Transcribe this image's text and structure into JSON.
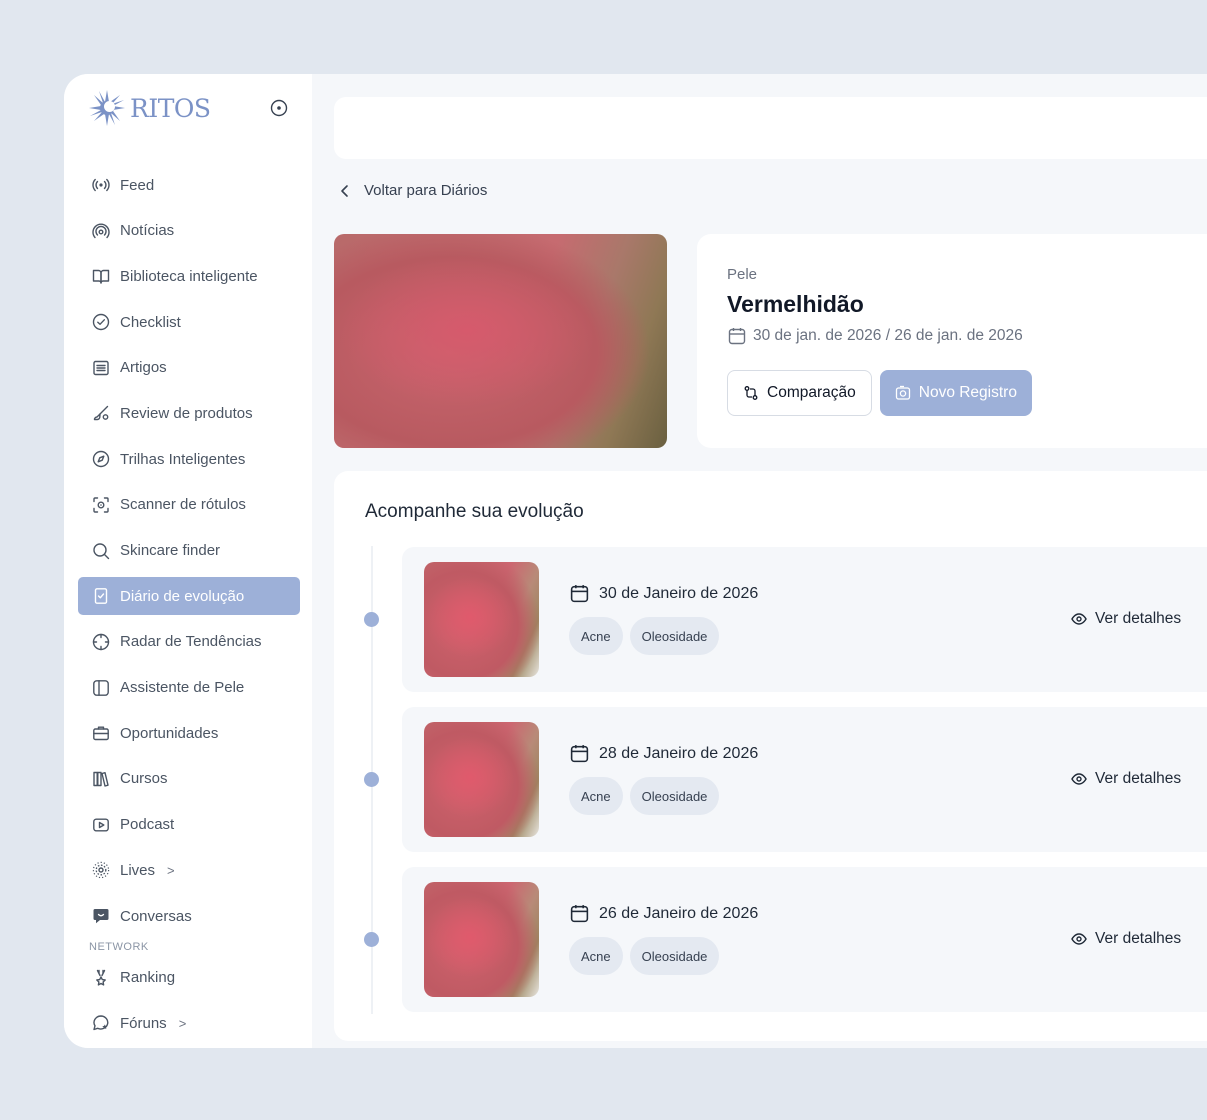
{
  "brand": {
    "name": "RITOS",
    "accent": "#9db0d8"
  },
  "sidebar": {
    "items": [
      {
        "label": "Feed",
        "icon": "broadcast-icon"
      },
      {
        "label": "Notícias",
        "icon": "signal-icon"
      },
      {
        "label": "Biblioteca inteligente",
        "icon": "book-open-icon"
      },
      {
        "label": "Checklist",
        "icon": "check-circle-icon"
      },
      {
        "label": "Artigos",
        "icon": "article-icon"
      },
      {
        "label": "Review de produtos",
        "icon": "brush-icon"
      },
      {
        "label": "Trilhas Inteligentes",
        "icon": "compass-icon"
      },
      {
        "label": "Scanner de rótulos",
        "icon": "scan-icon"
      },
      {
        "label": "Skincare finder",
        "icon": "search-icon"
      },
      {
        "label": "Diário de evolução",
        "icon": "diary-icon",
        "active": true
      },
      {
        "label": "Radar de Tendências",
        "icon": "crosshair-icon"
      },
      {
        "label": "Assistente de Pele",
        "icon": "panel-icon"
      },
      {
        "label": "Oportunidades",
        "icon": "briefcase-icon"
      },
      {
        "label": "Cursos",
        "icon": "books-icon"
      },
      {
        "label": "Podcast",
        "icon": "play-icon"
      },
      {
        "label": "Lives",
        "icon": "live-icon",
        "chevron": ">"
      },
      {
        "label": "Conversas",
        "icon": "chat-icon"
      }
    ],
    "section_label": "NETWORK",
    "network_items": [
      {
        "label": "Ranking",
        "icon": "medal-icon"
      },
      {
        "label": "Fóruns",
        "icon": "forum-icon",
        "chevron": ">"
      }
    ]
  },
  "main": {
    "back_label": "Voltar para Diários",
    "diary": {
      "category": "Pele",
      "title": "Vermelhidão",
      "dates": "30 de jan. de 2026 / 26 de jan. de 2026",
      "compare_label": "Comparação",
      "new_record_label": "Novo Registro"
    },
    "evolution": {
      "title": "Acompanhe sua evolução",
      "details_label": "Ver detalhes",
      "entries": [
        {
          "date": "30 de Janeiro de 2026",
          "tags": [
            "Acne",
            "Oleosidade"
          ]
        },
        {
          "date": "28 de Janeiro de 2026",
          "tags": [
            "Acne",
            "Oleosidade"
          ]
        },
        {
          "date": "26 de Janeiro de 2026",
          "tags": [
            "Acne",
            "Oleosidade"
          ]
        }
      ]
    }
  }
}
